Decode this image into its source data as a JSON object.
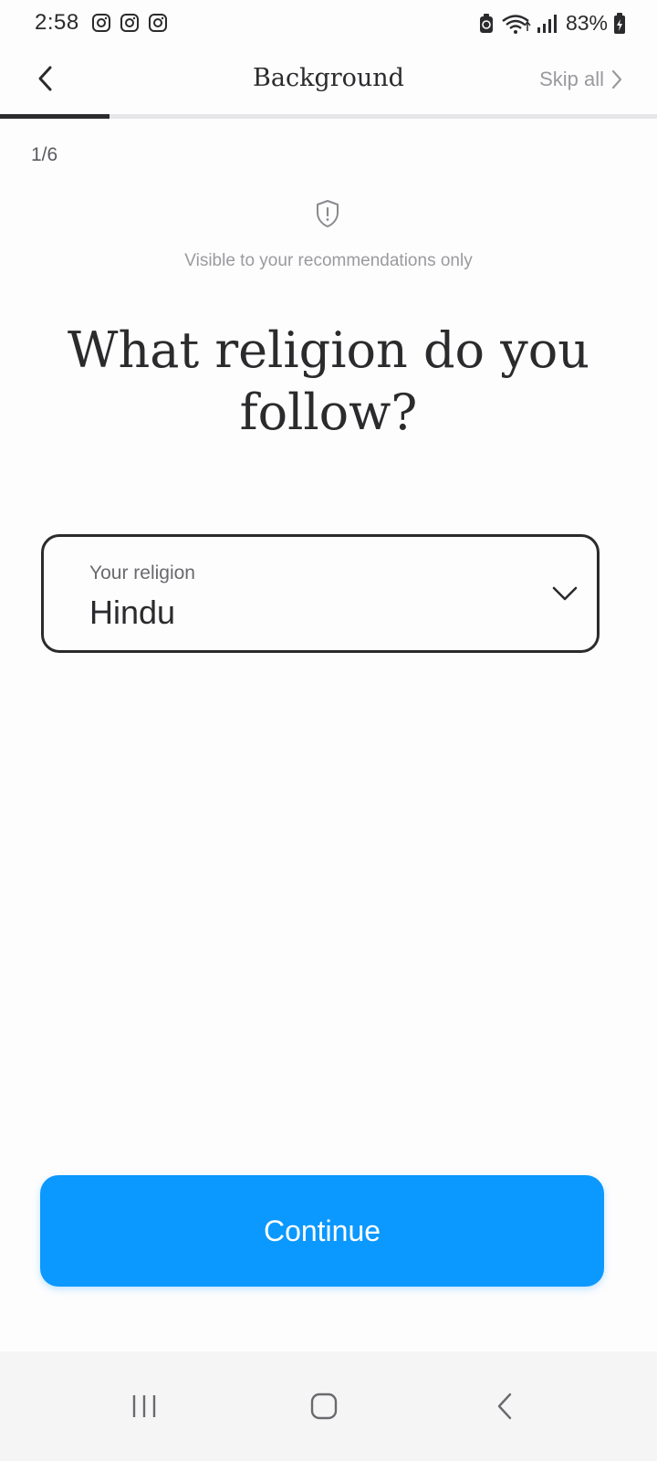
{
  "status_bar": {
    "time": "2:58",
    "battery_percent": "83%",
    "notification_icons": [
      "instagram-icon",
      "instagram-icon",
      "instagram-icon"
    ],
    "system_icons": [
      "battery-saver-icon",
      "wifi-icon",
      "signal-icon",
      "battery-charging-icon"
    ]
  },
  "header": {
    "title": "Background",
    "skip_label": "Skip all",
    "back_icon": "chevron-left-icon",
    "skip_icon": "chevron-right-icon",
    "progress_fraction": 0.1667
  },
  "step": {
    "counter": "1/6"
  },
  "privacy": {
    "icon": "shield-alert-icon",
    "note": "Visible to your recommendations only"
  },
  "question": {
    "text": "What religion do you follow?"
  },
  "religion_select": {
    "label": "Your religion",
    "value": "Hindu",
    "icon": "chevron-down-icon"
  },
  "actions": {
    "continue_label": "Continue"
  },
  "nav_bar": {
    "buttons": [
      "recent-apps-icon",
      "home-icon",
      "back-icon"
    ]
  },
  "colors": {
    "accent": "#0b98ff",
    "text": "#2b2b2d",
    "muted": "#9a9a9e",
    "background": "#fdfdfe"
  }
}
